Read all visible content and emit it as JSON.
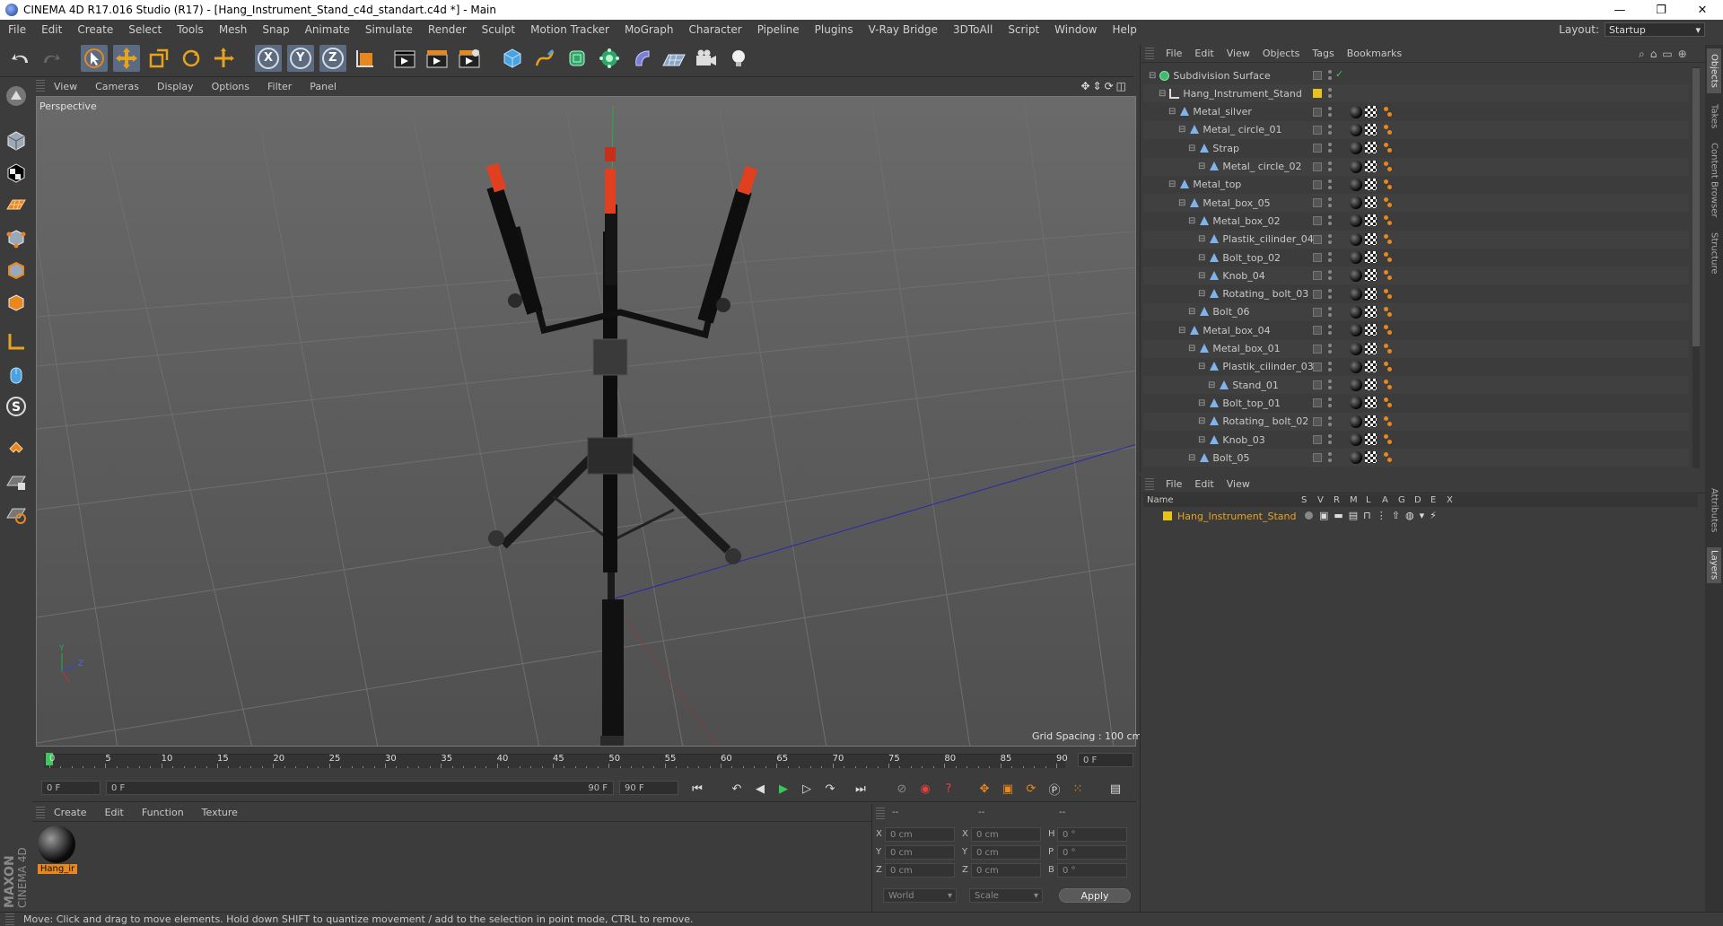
{
  "window": {
    "title": "CINEMA 4D R17.016 Studio (R17) - [Hang_Instrument_Stand_c4d_standart.c4d *] - Main",
    "minimize": "—",
    "maximize": "❐",
    "close": "✕"
  },
  "menubar": {
    "items": [
      "File",
      "Edit",
      "Create",
      "Select",
      "Tools",
      "Mesh",
      "Snap",
      "Animate",
      "Simulate",
      "Render",
      "Sculpt",
      "Motion Tracker",
      "MoGraph",
      "Character",
      "Pipeline",
      "Plugins",
      "V-Ray Bridge",
      "3DToAll",
      "Script",
      "Window",
      "Help"
    ],
    "layout_label": "Layout:",
    "layout_value": "Startup"
  },
  "toolbar": {
    "axis_x": "X",
    "axis_y": "Y",
    "axis_z": "Z"
  },
  "viewport": {
    "menu": [
      "View",
      "Cameras",
      "Display",
      "Options",
      "Filter",
      "Panel"
    ],
    "label": "Perspective",
    "grid_spacing": "Grid Spacing : 100 cm"
  },
  "timeline": {
    "ticks": [
      "0",
      "5",
      "10",
      "15",
      "20",
      "25",
      "30",
      "35",
      "40",
      "45",
      "50",
      "55",
      "60",
      "65",
      "70",
      "75",
      "80",
      "85",
      "90"
    ],
    "current_frame": "0 F",
    "start_field": "0 F",
    "range_start": "0 F",
    "range_end": "90 F",
    "end_field": "90 F",
    "playhead_fraction": 0
  },
  "material_manager": {
    "menu": [
      "Create",
      "Edit",
      "Function",
      "Texture"
    ],
    "material_name": "Hang_ir"
  },
  "coordinates": {
    "headers": [
      "--",
      "--",
      "--"
    ],
    "rows": [
      {
        "a": "X",
        "av": "0 cm",
        "b": "X",
        "bv": "0 cm",
        "c": "H",
        "cv": "0 °"
      },
      {
        "a": "Y",
        "av": "0 cm",
        "b": "Y",
        "bv": "0 cm",
        "c": "P",
        "cv": "0 °"
      },
      {
        "a": "Z",
        "av": "0 cm",
        "b": "Z",
        "bv": "0 cm",
        "c": "B",
        "cv": "0 °"
      }
    ],
    "world": "World",
    "scale": "Scale",
    "apply": "Apply"
  },
  "object_manager": {
    "menu": [
      "File",
      "Edit",
      "View",
      "Objects",
      "Tags",
      "Bookmarks"
    ],
    "objects": [
      {
        "name": "Subdivision Surface",
        "depth": 0,
        "icon": "sds"
      },
      {
        "name": "Hang_Instrument_Stand",
        "depth": 1,
        "icon": "null"
      },
      {
        "name": "Metal_silver",
        "depth": 2,
        "icon": "poly"
      },
      {
        "name": "Metal_ circle_01",
        "depth": 3,
        "icon": "poly"
      },
      {
        "name": "Strap",
        "depth": 4,
        "icon": "poly"
      },
      {
        "name": "Metal_ circle_02",
        "depth": 5,
        "icon": "poly"
      },
      {
        "name": "Metal_top",
        "depth": 2,
        "icon": "poly"
      },
      {
        "name": "Metal_box_05",
        "depth": 3,
        "icon": "poly"
      },
      {
        "name": "Metal_box_02",
        "depth": 4,
        "icon": "poly"
      },
      {
        "name": "Plastik_cilinder_04",
        "depth": 5,
        "icon": "poly"
      },
      {
        "name": "Bolt_top_02",
        "depth": 5,
        "icon": "poly"
      },
      {
        "name": "Knob_04",
        "depth": 5,
        "icon": "poly"
      },
      {
        "name": "Rotating_ bolt_03",
        "depth": 5,
        "icon": "poly"
      },
      {
        "name": "Bolt_06",
        "depth": 4,
        "icon": "poly"
      },
      {
        "name": "Metal_box_04",
        "depth": 3,
        "icon": "poly"
      },
      {
        "name": "Metal_box_01",
        "depth": 4,
        "icon": "poly"
      },
      {
        "name": "Plastik_cilinder_03",
        "depth": 5,
        "icon": "poly"
      },
      {
        "name": "Stand_01",
        "depth": 6,
        "icon": "poly"
      },
      {
        "name": "Bolt_top_01",
        "depth": 5,
        "icon": "poly"
      },
      {
        "name": "Rotating_ bolt_02",
        "depth": 5,
        "icon": "poly"
      },
      {
        "name": "Knob_03",
        "depth": 5,
        "icon": "poly"
      },
      {
        "name": "Bolt_05",
        "depth": 4,
        "icon": "poly"
      }
    ]
  },
  "layer_manager": {
    "menu": [
      "File",
      "Edit",
      "View"
    ],
    "columns": [
      "Name",
      "S",
      "V",
      "R",
      "M",
      "L",
      "A",
      "G",
      "D",
      "E",
      "X"
    ],
    "layer_name": "Hang_Instrument_Stand"
  },
  "side_tabs": [
    "Objects",
    "Takes",
    "Content Browser",
    "Structure",
    "Attributes",
    "Layers"
  ],
  "status": {
    "text": "Move: Click and drag to move elements. Hold down SHIFT to quantize movement / add to the selection in point mode, CTRL to remove."
  },
  "colors": {
    "accent_orange": "#e8871e",
    "layer_yellow": "#e8c21e",
    "selection_blue": "#5a6b82"
  }
}
